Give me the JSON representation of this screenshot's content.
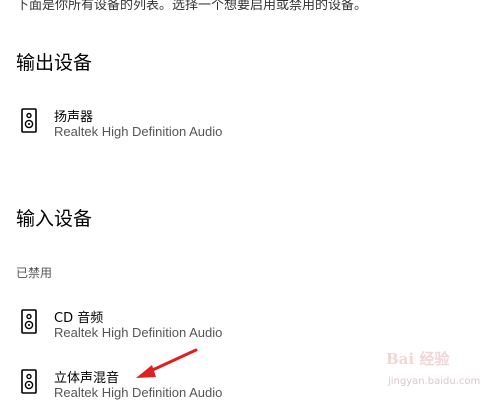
{
  "intro_text": "下面是你所有设备的列表。选择一个想要启用或禁用的设备。",
  "output_section": {
    "heading": "输出设备",
    "devices": [
      {
        "name": "扬声器",
        "driver": "Realtek High Definition Audio",
        "icon": "speaker-icon"
      }
    ]
  },
  "input_section": {
    "heading": "输入设备",
    "group_label": "已禁用",
    "devices": [
      {
        "name": "CD 音频",
        "driver": "Realtek High Definition Audio",
        "icon": "speaker-icon"
      },
      {
        "name": "立体声混音",
        "driver": "Realtek High Definition Audio",
        "icon": "speaker-icon"
      }
    ]
  },
  "annotation": {
    "color": "#e02020",
    "icon": "red-arrow-icon"
  },
  "watermark": {
    "brand": "Bai 经验",
    "sub": "jingyan.baidu.com"
  }
}
